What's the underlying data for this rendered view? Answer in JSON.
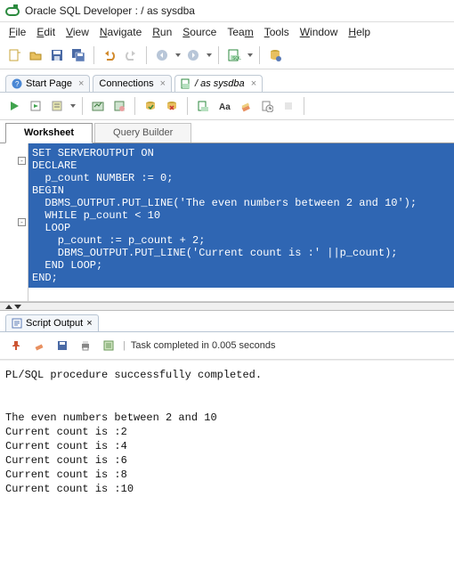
{
  "window_title": "Oracle SQL Developer : / as sysdba",
  "menubar": [
    "File",
    "Edit",
    "View",
    "Navigate",
    "Run",
    "Source",
    "Team",
    "Tools",
    "Window",
    "Help"
  ],
  "doc_tabs": [
    {
      "label": "Start Page",
      "icon": "help-icon"
    },
    {
      "label": "Connections",
      "icon": "folder"
    },
    {
      "label": "/ as sysdba",
      "icon": "sql-file",
      "active": true
    }
  ],
  "worksheet_tabs": [
    {
      "label": "Worksheet",
      "active": true
    },
    {
      "label": "Query Builder",
      "active": false
    }
  ],
  "code_lines": [
    "SET SERVEROUTPUT ON",
    "DECLARE",
    "  p_count NUMBER := 0;",
    "BEGIN",
    "  DBMS_OUTPUT.PUT_LINE('The even numbers between 2 and 10');",
    "  WHILE p_count < 10",
    "  LOOP",
    "    p_count := p_count + 2;",
    "    DBMS_OUTPUT.PUT_LINE('Current count is :' ||p_count);",
    "  END LOOP;",
    "END;"
  ],
  "gutter_folds": [
    {
      "line": 2,
      "sym": "-"
    },
    {
      "line": 7,
      "sym": "-"
    }
  ],
  "output_tab": {
    "label": "Script Output"
  },
  "output_status": "Task completed in 0.005 seconds",
  "output_text": "PL/SQL procedure successfully completed.\n\n\nThe even numbers between 2 and 10\nCurrent count is :2\nCurrent count is :4\nCurrent count is :6\nCurrent count is :8\nCurrent count is :10"
}
